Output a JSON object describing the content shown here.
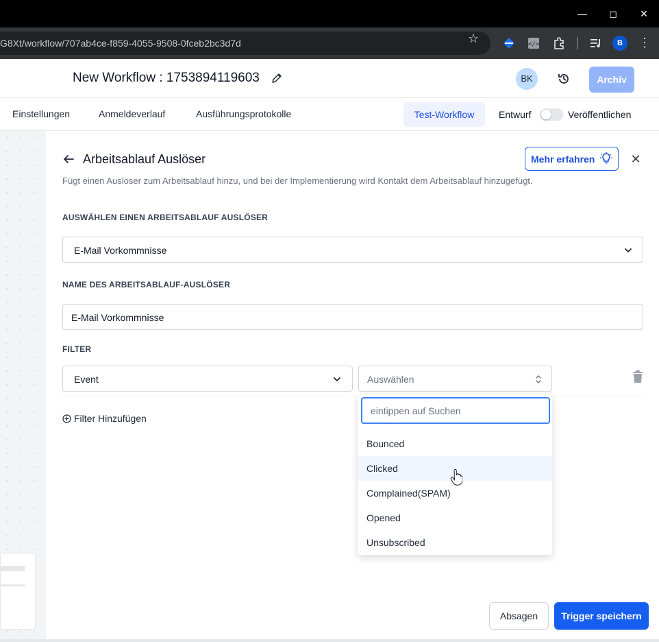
{
  "browser": {
    "url": "G8Xt/workflow/707ab4ce-f859-4055-9508-0fceb2bc3d7d",
    "profile_initial": "B"
  },
  "header": {
    "workflow_title": "New Workflow : 1753894119603",
    "avatar_initials": "BK",
    "archive_label": "Archiv"
  },
  "tabs": {
    "settings": "Einstellungen",
    "login_history": "Anmeldeverlauf",
    "execution_logs": "Ausführungsprotokolle",
    "test_workflow": "Test-Workflow",
    "draft": "Entwurf",
    "publish": "Veröffentlichen"
  },
  "panel": {
    "title": "Arbeitsablauf Auslöser",
    "learn_more": "Mehr erfahren",
    "description": "Fügt einen Auslöser zum Arbeitsablauf hinzu, und bei der Implementierung wird Kontakt dem Arbeitsablauf hinzugefügt.",
    "trigger_select_label": "AUSWÄHLEN EINEN ARBEITSABLAUF AUSLÖSER",
    "trigger_select_value": "E-Mail Vorkommnisse",
    "trigger_name_label": "NAME DES ARBEITSABLAUF-AUSLÖSER",
    "trigger_name_value": "E-Mail Vorkommnisse",
    "filter_label": "FILTER",
    "filter_field": "Event",
    "filter_value_placeholder": "Auswählen",
    "add_filter": "Filter Hinzufügen",
    "cancel": "Absagen",
    "save": "Trigger speichern"
  },
  "dropdown": {
    "search_placeholder": "eintippen auf Suchen",
    "options": [
      "Bounced",
      "Clicked",
      "Complained(SPAM)",
      "Opened",
      "Unsubscribed"
    ],
    "highlighted": "Clicked"
  },
  "colors": {
    "primary": "#155eef",
    "archive_button": "#93b4f8",
    "highlight_row": "#eff6ff"
  }
}
